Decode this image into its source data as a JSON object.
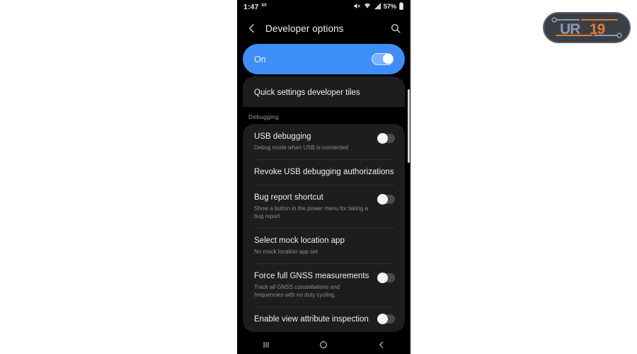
{
  "status_bar": {
    "time": "1:47",
    "temperature": "89",
    "battery": "57%",
    "icons": [
      "mute-icon",
      "wifi-icon",
      "signal-icon",
      "battery-icon"
    ]
  },
  "app_bar": {
    "back_icon": "chevron-left-icon",
    "title": "Developer options",
    "search_icon": "search-icon"
  },
  "master_toggle": {
    "label": "On",
    "state": "on"
  },
  "list": {
    "top_partial_item": {
      "title": "Quick settings developer tiles"
    },
    "section_header": "Debugging",
    "items": [
      {
        "title": "USB debugging",
        "subtitle": "Debug mode when USB is connected",
        "toggle": "off"
      },
      {
        "title": "Revoke USB debugging authorizations",
        "subtitle": "",
        "toggle": null
      },
      {
        "title": "Bug report shortcut",
        "subtitle": "Show a button in the power menu for taking a bug report",
        "toggle": "off"
      },
      {
        "title": "Select mock location app",
        "subtitle": "No mock location app set",
        "toggle": null
      },
      {
        "title": "Force full GNSS measurements",
        "subtitle": "Track all GNSS constellations and frequencies with no duty cycling.",
        "toggle": "off"
      },
      {
        "title": "Enable view attribute inspection",
        "subtitle": "",
        "toggle": "off"
      }
    ]
  },
  "nav_bar": {
    "recents_icon": "recents-icon",
    "home_icon": "home-circle-icon",
    "back_icon": "back-chevron-icon"
  },
  "watermark": {
    "text_primary": "UR",
    "text_secondary": "19",
    "color_primary": "#8b9bb0",
    "color_secondary": "#e8792b",
    "pill_color": "#3a3f46"
  },
  "colors": {
    "accent_blue": "#3d8ff7",
    "screen_bg": "#000000",
    "card_bg": "#1d1d1d",
    "page_bg": "#ffffff"
  }
}
